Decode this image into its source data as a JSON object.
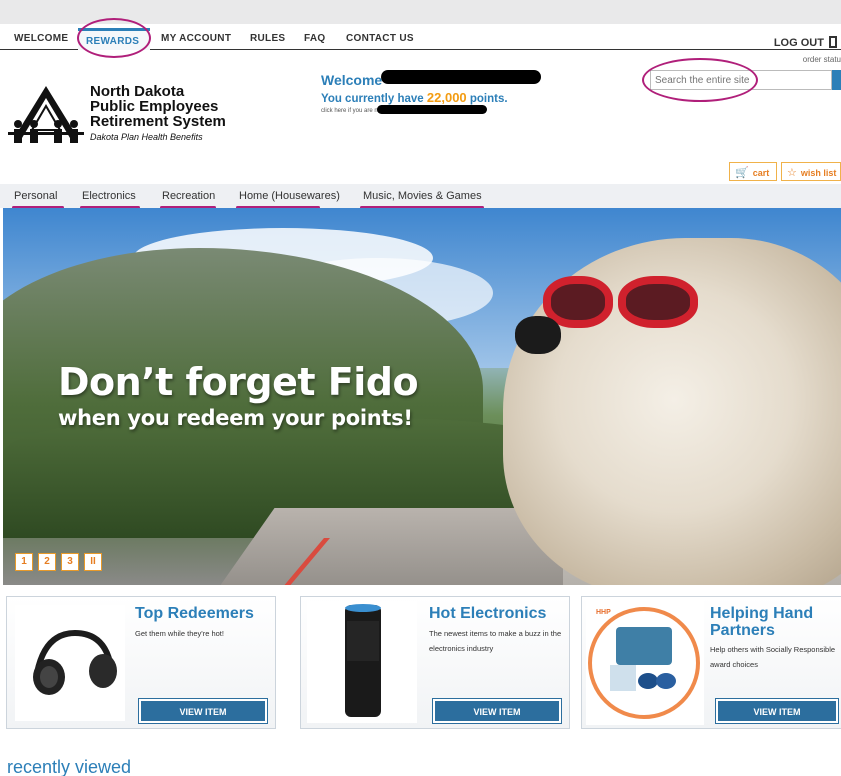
{
  "top_nav": {
    "items": [
      "WELCOME",
      "REWARDS",
      "MY ACCOUNT",
      "RULES",
      "FAQ",
      "CONTACT US"
    ],
    "active": "REWARDS",
    "logout_label": "LOG OUT",
    "order_status": "order statu"
  },
  "org": {
    "line1": "North Dakota",
    "line2": "Public Employees",
    "line3": "Retirement System",
    "tagline": "Dakota Plan Health Benefits"
  },
  "welcome": {
    "greeting": "Welcome",
    "points_prefix": "You currently have",
    "points": "22,000",
    "points_suffix": "points.",
    "not_you": "click here if you are not"
  },
  "search": {
    "placeholder": "Search the entire site"
  },
  "cart": {
    "cart_label": "cart",
    "wish_label": "wish list"
  },
  "categories": [
    "Personal",
    "Electronics",
    "Recreation",
    "Home (Housewares)",
    "Music, Movies & Games"
  ],
  "hero": {
    "headline": "Don’t forget Fido",
    "subline": "when you redeem your points!",
    "pages": [
      "1",
      "2",
      "3",
      "II"
    ]
  },
  "cards": [
    {
      "title": "Top Redeemers",
      "desc": "Get them while they're hot!",
      "button": "VIEW ITEM"
    },
    {
      "title": "Hot Electronics",
      "desc": "The newest items to make a buzz in the electronics industry",
      "button": "VIEW ITEM"
    },
    {
      "title_line1": "Helping Hand",
      "title_line2": "Partners",
      "desc": "Help others with Socially Responsible award choices",
      "button": "VIEW ITEM",
      "badge": "HHP"
    }
  ],
  "recently_viewed": "recently viewed",
  "colors": {
    "brand_blue": "#2c7fb8",
    "accent_orange": "#f39c12",
    "annotation_magenta": "#b01f7a"
  }
}
